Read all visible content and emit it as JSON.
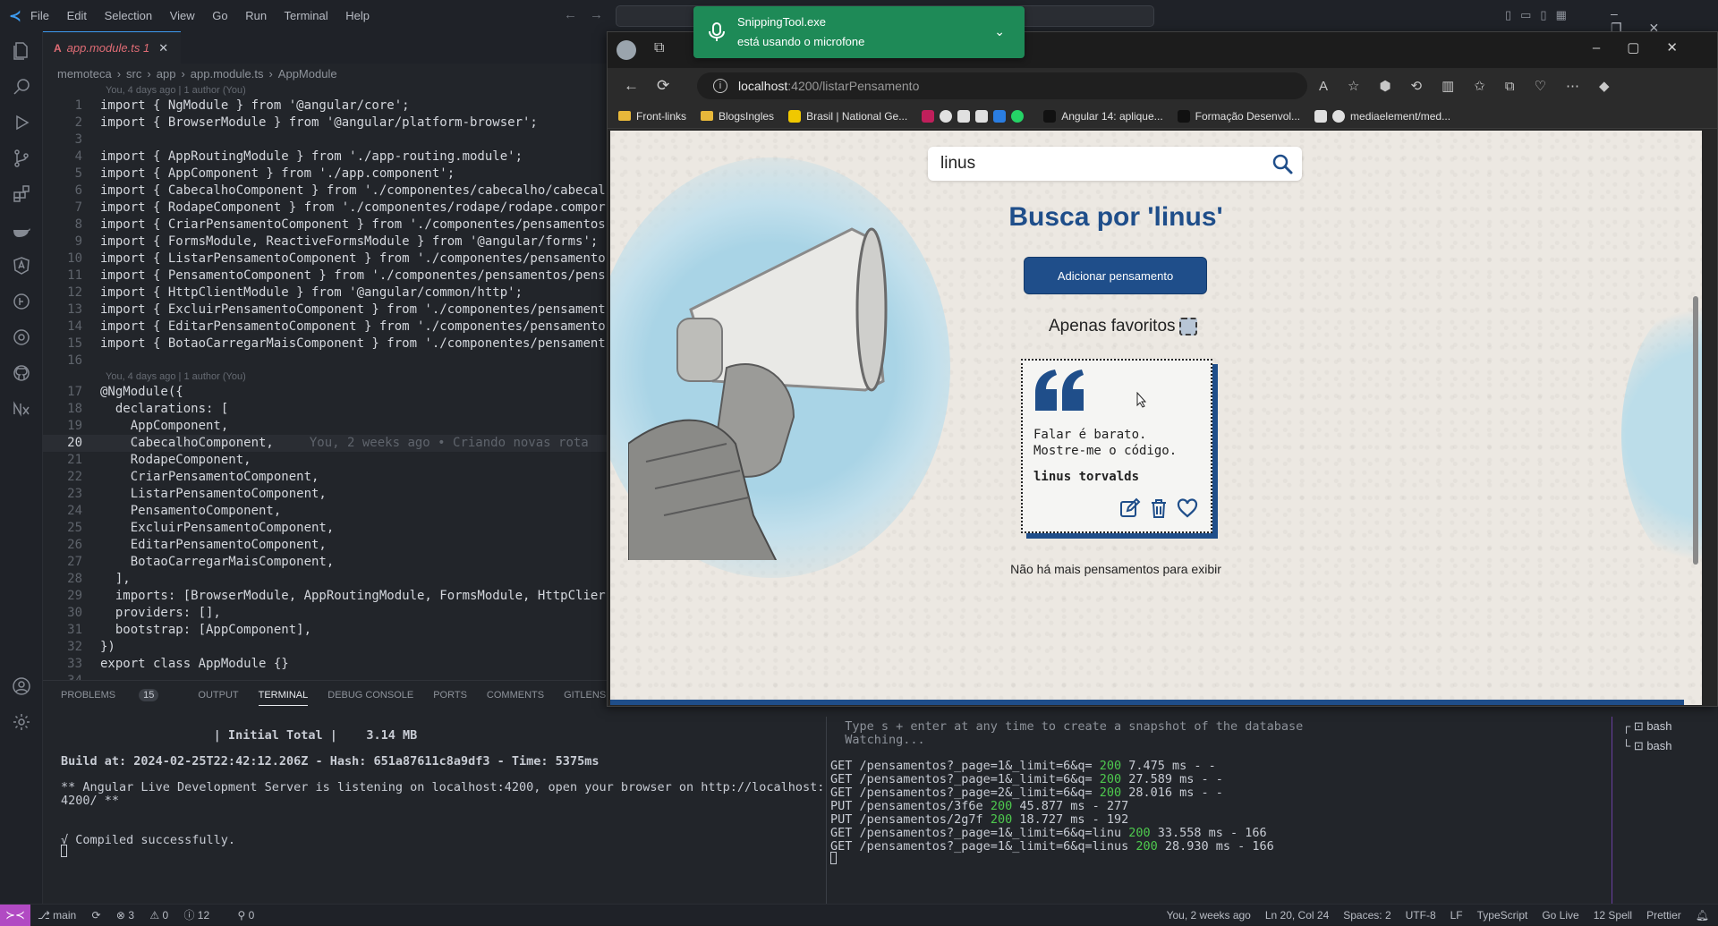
{
  "vscode": {
    "menu": [
      "File",
      "Edit",
      "Selection",
      "View",
      "Go",
      "Run",
      "Terminal",
      "Help"
    ],
    "tab": {
      "filename": "app.module.ts",
      "modified_count": "1"
    },
    "breadcrumb": [
      "memoteca",
      "src",
      "app",
      "app.module.ts",
      "AppModule"
    ],
    "blame1": "You, 4 days ago | 1 author (You)",
    "blame2": "You, 4 days ago | 1 author (You)",
    "inline_blame": "You, 2 weeks ago • Criando novas rota",
    "code_block1": [
      {
        "n": "1",
        "t": "import { NgModule } from '@angular/core';"
      },
      {
        "n": "2",
        "t": "import { BrowserModule } from '@angular/platform-browser';"
      },
      {
        "n": "3",
        "t": ""
      },
      {
        "n": "4",
        "t": "import { AppRoutingModule } from './app-routing.module';"
      },
      {
        "n": "5",
        "t": "import { AppComponent } from './app.component';"
      },
      {
        "n": "6",
        "t": "import { CabecalhoComponent } from './componentes/cabecalho/cabecal"
      },
      {
        "n": "7",
        "t": "import { RodapeComponent } from './componentes/rodape/rodape.compor"
      },
      {
        "n": "8",
        "t": "import { CriarPensamentoComponent } from './componentes/pensamentos"
      },
      {
        "n": "9",
        "t": "import { FormsModule, ReactiveFormsModule } from '@angular/forms';"
      },
      {
        "n": "10",
        "t": "import { ListarPensamentoComponent } from './componentes/pensamento"
      },
      {
        "n": "11",
        "t": "import { PensamentoComponent } from './componentes/pensamentos/pens"
      },
      {
        "n": "12",
        "t": "import { HttpClientModule } from '@angular/common/http';"
      },
      {
        "n": "13",
        "t": "import { ExcluirPensamentoComponent } from './componentes/pensament"
      },
      {
        "n": "14",
        "t": "import { EditarPensamentoComponent } from './componentes/pensamento"
      },
      {
        "n": "15",
        "t": "import { BotaoCarregarMaisComponent } from './componentes/pensament"
      },
      {
        "n": "16",
        "t": ""
      }
    ],
    "code_block2": [
      {
        "n": "17",
        "t": "@NgModule({"
      },
      {
        "n": "18",
        "t": "  declarations: ["
      },
      {
        "n": "19",
        "t": "    AppComponent,"
      },
      {
        "n": "20",
        "t": "    CabecalhoComponent,"
      },
      {
        "n": "21",
        "t": "    RodapeComponent,"
      },
      {
        "n": "22",
        "t": "    CriarPensamentoComponent,"
      },
      {
        "n": "23",
        "t": "    ListarPensamentoComponent,"
      },
      {
        "n": "24",
        "t": "    PensamentoComponent,"
      },
      {
        "n": "25",
        "t": "    ExcluirPensamentoComponent,"
      },
      {
        "n": "26",
        "t": "    EditarPensamentoComponent,"
      },
      {
        "n": "27",
        "t": "    BotaoCarregarMaisComponent,"
      },
      {
        "n": "28",
        "t": "  ],"
      },
      {
        "n": "29",
        "t": "  imports: [BrowserModule, AppRoutingModule, FormsModule, HttpClier"
      },
      {
        "n": "30",
        "t": "  providers: [],"
      },
      {
        "n": "31",
        "t": "  bootstrap: [AppComponent],"
      },
      {
        "n": "32",
        "t": "})"
      },
      {
        "n": "33",
        "t": "export class AppModule {}"
      },
      {
        "n": "34",
        "t": ""
      }
    ],
    "panel_tabs": {
      "problems": "PROBLEMS",
      "problems_count": "15",
      "output": "OUTPUT",
      "terminal": "TERMINAL",
      "debug": "DEBUG CONSOLE",
      "ports": "PORTS",
      "comments": "COMMENTS",
      "gitlens": "GITLENS"
    },
    "terminal_left": [
      "                     | Initial Total |    3.14 MB",
      "",
      "Build at: 2024-02-25T22:42:12.206Z - Hash: 651a87611c8a9df3 - Time: 5375ms",
      "",
      "** Angular Live Development Server is listening on localhost:4200, open your browser on http://localhost:",
      "4200/ **",
      "",
      "",
      "√ Compiled successfully."
    ],
    "terminal_right_header": [
      "  Type s + enter at any time to create a snapshot of the database",
      "  Watching..."
    ],
    "terminal_right": [
      {
        "pre": "GET /pensamentos?_page=1&_limit=6&q= ",
        "code": "200",
        "post": " 7.475 ms - -"
      },
      {
        "pre": "GET /pensamentos?_page=1&_limit=6&q= ",
        "code": "200",
        "post": " 27.589 ms - -"
      },
      {
        "pre": "GET /pensamentos?_page=2&_limit=6&q= ",
        "code": "200",
        "post": " 28.016 ms - -"
      },
      {
        "pre": "PUT /pensamentos/3f6e ",
        "code": "200",
        "post": " 45.877 ms - 277"
      },
      {
        "pre": "PUT /pensamentos/2g7f ",
        "code": "200",
        "post": " 18.727 ms - 192"
      },
      {
        "pre": "GET /pensamentos?_page=1&_limit=6&q=linu ",
        "code": "200",
        "post": " 33.558 ms - 166"
      },
      {
        "pre": "GET /pensamentos?_page=1&_limit=6&q=linus ",
        "code": "200",
        "post": " 28.930 ms - 166"
      }
    ],
    "bash_terminals": [
      "bash",
      "bash"
    ],
    "status": {
      "branch": "main",
      "errors": "3",
      "warnings": "0",
      "info": "12",
      "ports": "0",
      "blame": "You, 2 weeks ago",
      "position": "Ln 20, Col 24",
      "spaces": "Spaces: 2",
      "encoding": "UTF-8",
      "eol": "LF",
      "language": "TypeScript",
      "golive": "Go Live",
      "spell": "12 Spell",
      "prettier": "Prettier"
    }
  },
  "browser": {
    "url_host": "localhost",
    "url_path": ":4200/listarPensamento",
    "bookmarks": [
      "Front-links",
      "BlogsIngles",
      "Brasil | National Ge...",
      "Angular 14: aplique...",
      "Formação Desenvol...",
      "mediaelement/med..."
    ],
    "page": {
      "search_value": "linus",
      "title": "Busca por 'linus'",
      "add_button": "Adicionar pensamento",
      "favorites_label": "Apenas favoritos",
      "favorites_checked": false,
      "card": {
        "text": "Falar é barato. Mostre-me o código.",
        "author": "linus torvalds"
      },
      "no_more": "Não há mais pensamentos para exibir"
    },
    "accent_color": "#1f4e8a"
  },
  "toast": {
    "app": "SnippingTool.exe",
    "message": "está usando o microfone",
    "color": "#1e8a57"
  }
}
